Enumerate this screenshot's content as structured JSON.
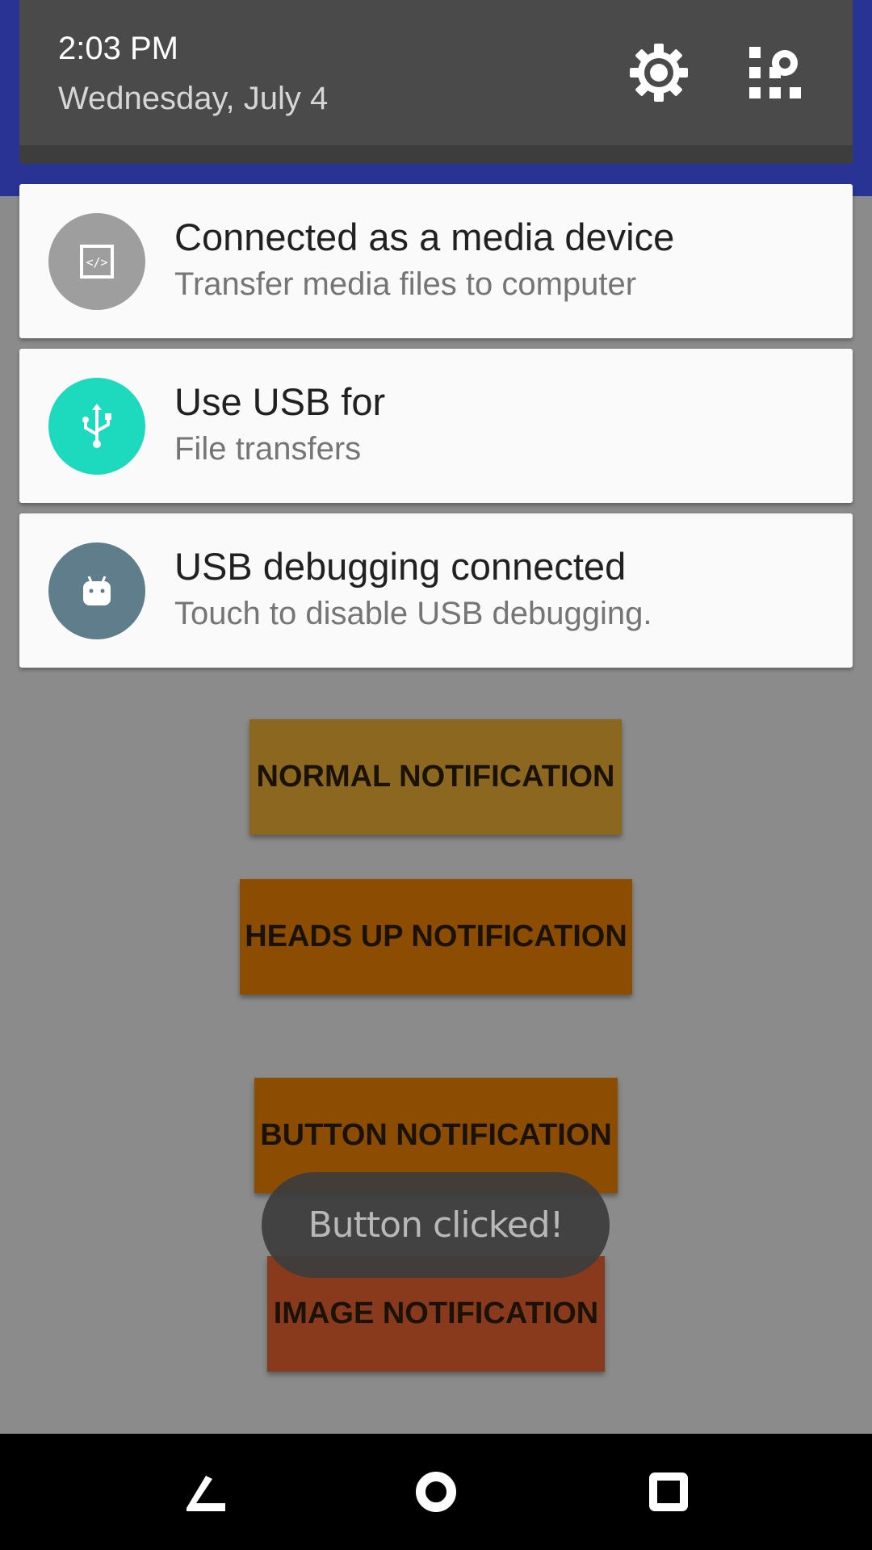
{
  "shade": {
    "time": "2:03 PM",
    "date": "Wednesday, July 4",
    "icons": [
      "settings-gear-icon",
      "quick-settings-tiles-icon"
    ]
  },
  "notifications": [
    {
      "icon": "code-icon",
      "icon_bg": "#9e9e9e",
      "title": "Connected as a media device",
      "subtitle": "Transfer media files to computer"
    },
    {
      "icon": "usb-icon",
      "icon_bg": "#1dd9be",
      "title": "Use USB for",
      "subtitle": "File transfers"
    },
    {
      "icon": "android-icon",
      "icon_bg": "#607d8b",
      "title": "USB debugging connected",
      "subtitle": "Touch to disable USB debugging."
    }
  ],
  "app": {
    "buttons": [
      {
        "label": "NORMAL NOTIFICATION",
        "color": "#8c6720"
      },
      {
        "label": "HEADS UP NOTIFICATION",
        "color": "#8c4c02"
      },
      {
        "label": "BUTTON NOTIFICATION",
        "color": "#8c4c02"
      },
      {
        "label": "IMAGE NOTIFICATION",
        "color": "#8a3a1c"
      }
    ],
    "toast": "Button clicked!"
  },
  "navbar": {
    "icons": [
      "back-icon",
      "home-icon",
      "recents-icon"
    ]
  }
}
